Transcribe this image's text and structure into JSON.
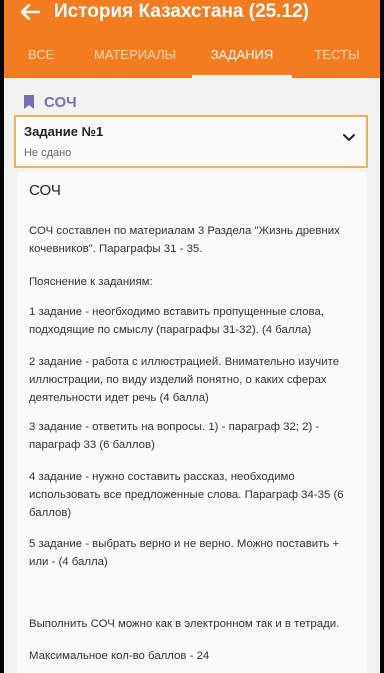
{
  "app": {
    "title": "История Казахстана (25.12)"
  },
  "tabs": [
    {
      "label": "ВСЕ"
    },
    {
      "label": "МАТЕРИАЛЫ"
    },
    {
      "label": "ЗАДАНИЯ",
      "active": true
    },
    {
      "label": "ТЕСТЫ"
    }
  ],
  "section": {
    "label": "СОЧ"
  },
  "task": {
    "title": "Задание №1",
    "status": "Не сдано"
  },
  "content": {
    "heading": "СОЧ",
    "paragraphs": [
      "СОЧ составлен по материалам 3 Раздела \"Жизнь древних кочевников\". Параграфы 31 - 35.",
      "Пояснение к заданиям:",
      "1 задание - неогбходимо вставить пропущенные слова, подходящие по смыслу (параграфы 31-32). (4 балла)",
      "2 задание - работа с иллюстрацией. Внимательно изучите иллюстрации, по виду изделий понятно, о каких сферах деятельности идет речь (4 балла)",
      "3 задание - ответить на вопросы. 1) - параграф 32; 2) - параграф 33 (6 баллов)",
      "4 задание - нужно составить рассказ, необходимо использовать все предложенные слова. Параграф 34-35 (6 баллов)",
      "5 задание - выбрать верно и не верно. Можно поставить + или - (4 балла)",
      "Выполнить СОЧ можно как в электронном так и в тетради.",
      "Максимальное кол-во баллов - 24"
    ]
  },
  "colors": {
    "appbar": "#f47c20",
    "accent_border": "#f0b24a",
    "section_label": "#7a6cb6"
  },
  "icons": {
    "back": "arrow-left-icon",
    "bookmark": "bookmark-icon",
    "expand": "chevron-down-icon"
  }
}
